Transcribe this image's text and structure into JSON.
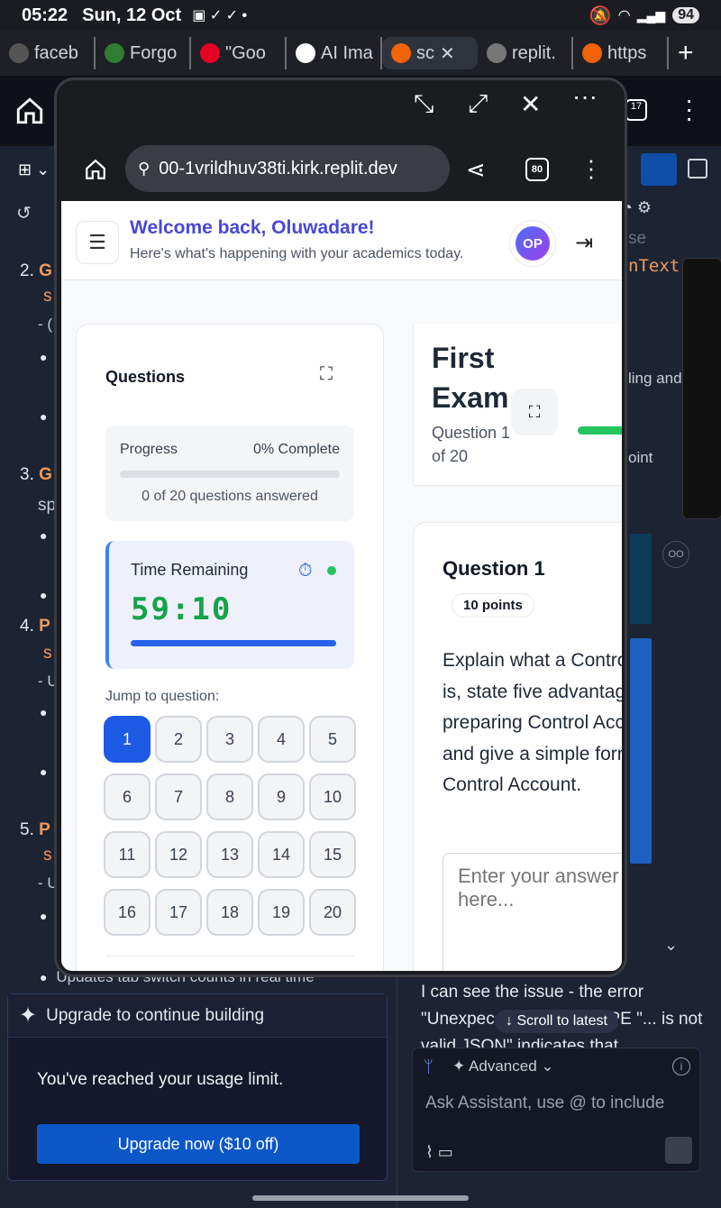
{
  "status_bar": {
    "time": "05:22",
    "date": "Sun, 12 Oct",
    "battery": "94"
  },
  "browser_tabs": [
    {
      "label": "faceb",
      "color": "#555"
    },
    {
      "label": "Forgo",
      "color": "#2e7d32"
    },
    {
      "label": "\"Goo",
      "color": "#e60023"
    },
    {
      "label": "AI Ima",
      "color": "#fff"
    },
    {
      "label": "sc",
      "color": "#f26207",
      "active": true
    },
    {
      "label": "replit.",
      "color": "#777"
    },
    {
      "label": "https",
      "color": "#f26207"
    }
  ],
  "colors": {
    "accent": "#1d5be4",
    "brand_purple": "#4a47d8",
    "timer_green": "#16a34a",
    "upgrade_blue": "#0b57c8"
  },
  "left_panel": {
    "items": [
      {
        "num": "2.",
        "title": "G",
        "rest": "s"
      },
      {
        "num": "3.",
        "title": "G",
        "rest": "sp"
      },
      {
        "num": "4.",
        "title": "P",
        "rest": "s"
      },
      {
        "num": "5.",
        "title": "P",
        "rest": "s"
      }
    ],
    "trailing_bullet": "Updates tab switch counts in real time",
    "upgrade": {
      "heading": "Upgrade to continue building",
      "message": "You've reached your usage limit.",
      "button": "Upgrade now ($10 off)"
    }
  },
  "right_panel": {
    "partial_text_1": "se",
    "partial_text_2": "nText",
    "partial_text_3": "ling and",
    "partial_text_4": "oint",
    "message": "I can see the issue - the error \"Unexpec",
    "message_tail": "OCTYPE \"... is not valid JSON\" indicates that",
    "scroll_latest": "Scroll to latest",
    "assistant": {
      "mode": "Advanced",
      "placeholder": "Ask Assistant, use @ to include"
    }
  },
  "popup": {
    "url": "00-1vrildhuv38ti.kirk.replit.dev",
    "tab_count": "80",
    "header": {
      "welcome": "Welcome back, Oluwadare!",
      "subtitle": "Here's what's happening with your academics today.",
      "avatar": "OP"
    },
    "questions_panel": {
      "title": "Questions",
      "progress_label": "Progress",
      "progress_pct": "0% Complete",
      "progress_fraction": 0,
      "answered": "0 of 20 questions answered",
      "time_label": "Time Remaining",
      "time_value": "59:10",
      "jump_label": "Jump to question:",
      "question_numbers": [
        "1",
        "2",
        "3",
        "4",
        "5",
        "6",
        "7",
        "8",
        "9",
        "10",
        "11",
        "12",
        "13",
        "14",
        "15",
        "16",
        "17",
        "18",
        "19",
        "20"
      ],
      "current": "1"
    },
    "exam": {
      "title": "First Exam",
      "question_of": "Question 1 of 20",
      "question_title": "Question 1",
      "points": "10 points",
      "question_text": "Explain what a Control Account is, state five advantages of preparing Control Accounts, and give a simple format of a Control Account.",
      "answer_placeholder": "Enter your answer here..."
    }
  }
}
